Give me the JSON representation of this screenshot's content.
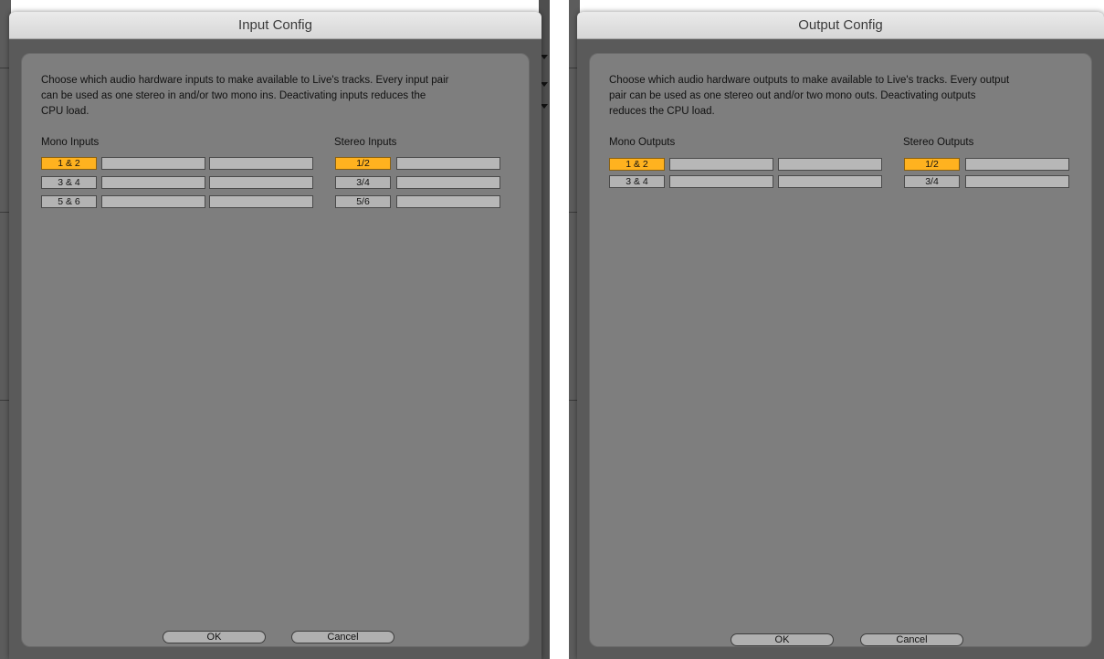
{
  "input_dialog": {
    "title": "Input Config",
    "description_lines": [
      "Choose which audio hardware inputs to make available to Live's tracks. Every input pair",
      "can be used as one stereo in and/or two mono ins.  Deactivating inputs reduces the",
      "CPU load."
    ],
    "mono_label": "Mono Inputs",
    "stereo_label": "Stereo Inputs",
    "mono_rows": [
      {
        "label": "1 & 2",
        "active": true
      },
      {
        "label": "3 & 4",
        "active": false
      },
      {
        "label": "5 & 6",
        "active": false
      }
    ],
    "stereo_rows": [
      {
        "label": "1/2",
        "active": true
      },
      {
        "label": "3/4",
        "active": false
      },
      {
        "label": "5/6",
        "active": false
      }
    ],
    "ok_label": "OK",
    "cancel_label": "Cancel"
  },
  "output_dialog": {
    "title": "Output Config",
    "description_lines": [
      "Choose which audio hardware outputs to make available to Live's tracks. Every output",
      "pair can be used as one stereo out and/or two mono outs.  Deactivating outputs",
      "reduces the CPU load."
    ],
    "mono_label": "Mono Outputs",
    "stereo_label": "Stereo Outputs",
    "mono_rows": [
      {
        "label": "1 & 2",
        "active": true
      },
      {
        "label": "3 & 4",
        "active": false
      }
    ],
    "stereo_rows": [
      {
        "label": "1/2",
        "active": true
      },
      {
        "label": "3/4",
        "active": false
      }
    ],
    "ok_label": "OK",
    "cancel_label": "Cancel"
  },
  "colors": {
    "active": "#ffb21f",
    "inactive": "#b3b3b3",
    "panel": "#7e7e7e"
  }
}
